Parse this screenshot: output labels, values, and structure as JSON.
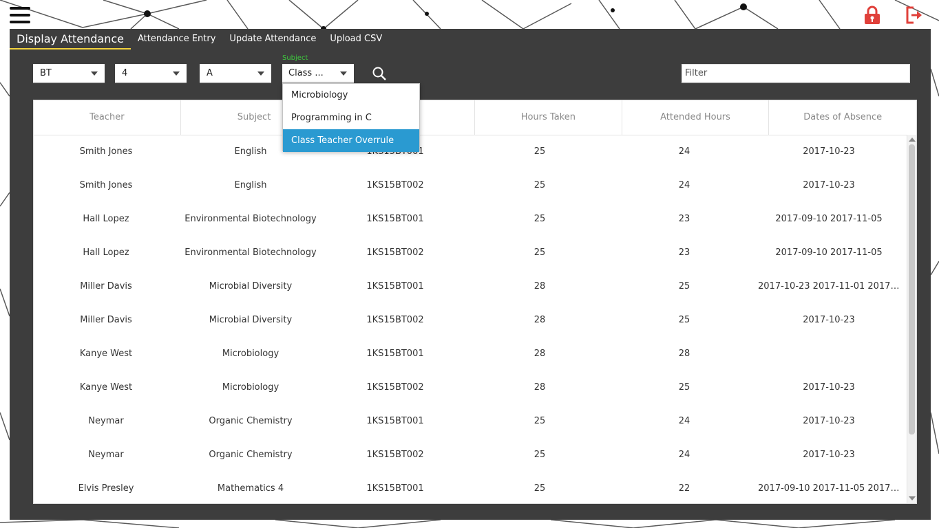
{
  "colors": {
    "panel": "#3d3d3d",
    "tab_underline": "#f2d23c",
    "icon_red": "#e0403a",
    "label_green": "#3ec83e",
    "selected_blue": "#2a9ad1"
  },
  "topbar": {
    "menu_icon": "hamburger-menu-icon",
    "lock_icon": "lock-icon",
    "logout_icon": "logout-icon"
  },
  "tabs": [
    {
      "label": "Display Attendance",
      "active": true
    },
    {
      "label": "Attendance Entry"
    },
    {
      "label": "Update Attendance"
    },
    {
      "label": "Upload CSV"
    }
  ],
  "filters": {
    "branch": "BT",
    "semester": "4",
    "section": "A",
    "subject_label": "Subject",
    "subject_value": "Class ...",
    "search_icon": "search-icon",
    "filter_placeholder": "Filter"
  },
  "subject_dropdown": {
    "options": [
      "Microbiology",
      "Programming in C",
      "Class Teacher Overrule"
    ],
    "selected": "Class Teacher Overrule"
  },
  "table": {
    "headers": [
      "Teacher",
      "Subject",
      "",
      "Hours Taken",
      "Attended Hours",
      "Dates of Absence"
    ],
    "rows": [
      [
        "Smith Jones",
        "English",
        "1KS15BT001",
        "25",
        "24",
        "2017-10-23"
      ],
      [
        "Smith Jones",
        "English",
        "1KS15BT002",
        "25",
        "24",
        "2017-10-23"
      ],
      [
        "Hall Lopez",
        "Environmental Biotechnology",
        "1KS15BT001",
        "25",
        "23",
        "2017-09-10 2017-11-05"
      ],
      [
        "Hall Lopez",
        "Environmental Biotechnology",
        "1KS15BT002",
        "25",
        "23",
        "2017-09-10 2017-11-05"
      ],
      [
        "Miller Davis",
        "Microbial Diversity",
        "1KS15BT001",
        "28",
        "25",
        "2017-10-23 2017-11-01 2017-11..."
      ],
      [
        "Miller Davis",
        "Microbial Diversity",
        "1KS15BT002",
        "28",
        "25",
        "2017-10-23"
      ],
      [
        "Kanye West",
        "Microbiology",
        "1KS15BT001",
        "28",
        "28",
        ""
      ],
      [
        "Kanye West",
        "Microbiology",
        "1KS15BT002",
        "28",
        "25",
        "2017-10-23"
      ],
      [
        "Neymar",
        "Organic Chemistry",
        "1KS15BT001",
        "25",
        "24",
        "2017-10-23"
      ],
      [
        "Neymar",
        "Organic Chemistry",
        "1KS15BT002",
        "25",
        "24",
        "2017-10-23"
      ],
      [
        "Elvis Presley",
        "Mathematics 4",
        "1KS15BT001",
        "25",
        "22",
        "2017-09-10 2017-11-05 2017-0..."
      ]
    ]
  }
}
